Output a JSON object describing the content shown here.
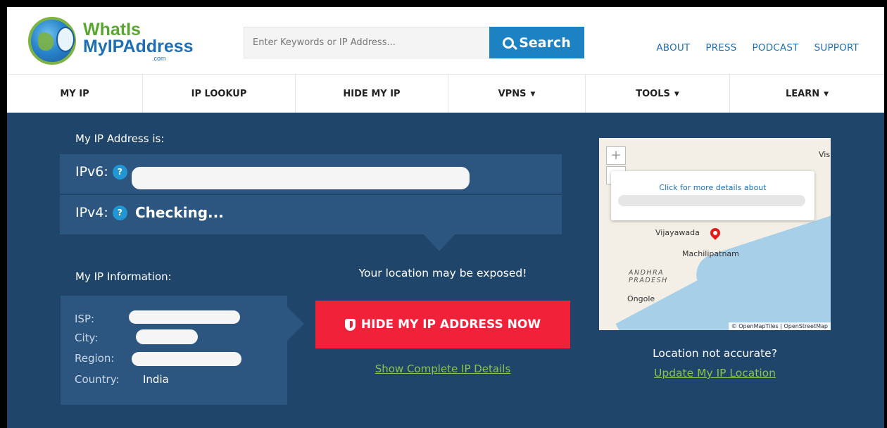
{
  "header": {
    "logo": {
      "line1": "WhatIs",
      "line2": "MyIPAddress",
      "line3": ".com"
    },
    "search": {
      "placeholder": "Enter Keywords or IP Address...",
      "button_label": "Search"
    },
    "top_links": [
      "ABOUT",
      "PRESS",
      "PODCAST",
      "SUPPORT"
    ]
  },
  "nav": {
    "items": [
      {
        "label": "MY IP",
        "has_dropdown": false
      },
      {
        "label": "IP LOOKUP",
        "has_dropdown": false
      },
      {
        "label": "HIDE MY IP",
        "has_dropdown": false
      },
      {
        "label": "VPNS",
        "has_dropdown": true
      },
      {
        "label": "TOOLS",
        "has_dropdown": true
      },
      {
        "label": "LEARN",
        "has_dropdown": true
      }
    ],
    "caret": "▼"
  },
  "main": {
    "ip_heading": "My IP Address is:",
    "ipv6": {
      "label": "IPv6:",
      "help": "?",
      "value": ""
    },
    "ipv4": {
      "label": "IPv4:",
      "help": "?",
      "value": "Checking..."
    },
    "info_heading": "My IP Information:",
    "info": [
      {
        "label": "ISP:",
        "value": ""
      },
      {
        "label": "City:",
        "value": ""
      },
      {
        "label": "Region:",
        "value": ""
      },
      {
        "label": "Country:",
        "value": "India"
      }
    ],
    "exposed_text": "Your location may be exposed!",
    "hide_button_label": "HIDE MY IP ADDRESS NOW",
    "show_details_link": "Show Complete IP Details",
    "map": {
      "zoom_in": "+",
      "zoom_out": "−",
      "popup_text": "Click for more details about",
      "places": [
        "Vijayawada",
        "Machilipatnam",
        "Ongole",
        "Vis"
      ],
      "region_label": [
        "ANDHRA",
        "PRADESH"
      ],
      "attribution": "© OpenMapTiles | OpenStreetMap"
    },
    "not_accurate_text": "Location not accurate?",
    "update_location_link": "Update My IP Location"
  },
  "colors": {
    "brand_blue": "#1f6fb4",
    "search_button": "#1d82c3",
    "main_bg": "#1f456a",
    "panel_bg": "#2c5680",
    "hide_button": "#f2213a",
    "link_green": "#8bc34a"
  }
}
